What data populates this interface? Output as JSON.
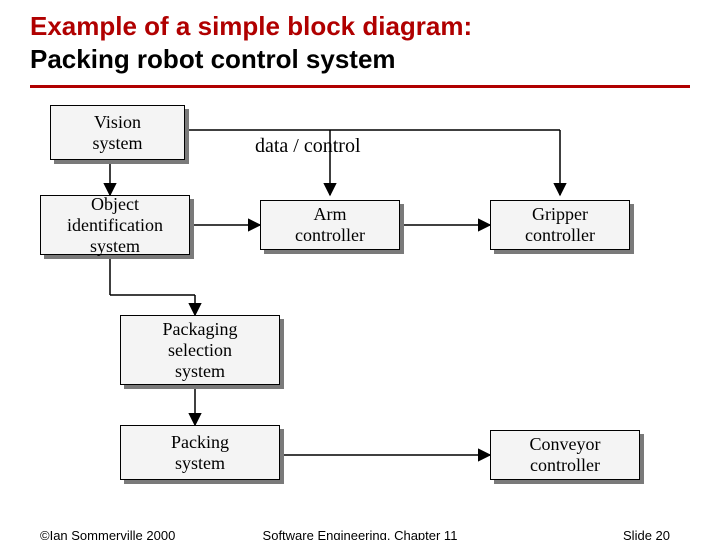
{
  "title": {
    "line1": "Example of a simple block diagram:",
    "line2": "Packing robot control system"
  },
  "annotation": "data / control",
  "blocks": {
    "vision": "Vision\nsystem",
    "object_id": "Object\nidentification\nsystem",
    "arm": "Arm\ncontroller",
    "gripper": "Gripper\ncontroller",
    "pkg_sel": "Packaging\nselection\nsystem",
    "packing": "Packing\nsystem",
    "conveyor": "Conveyor\ncontroller"
  },
  "footer": {
    "left": "©Ian Sommerville 2000",
    "center": "Software Engineering. Chapter 11",
    "right": "Slide 20"
  }
}
